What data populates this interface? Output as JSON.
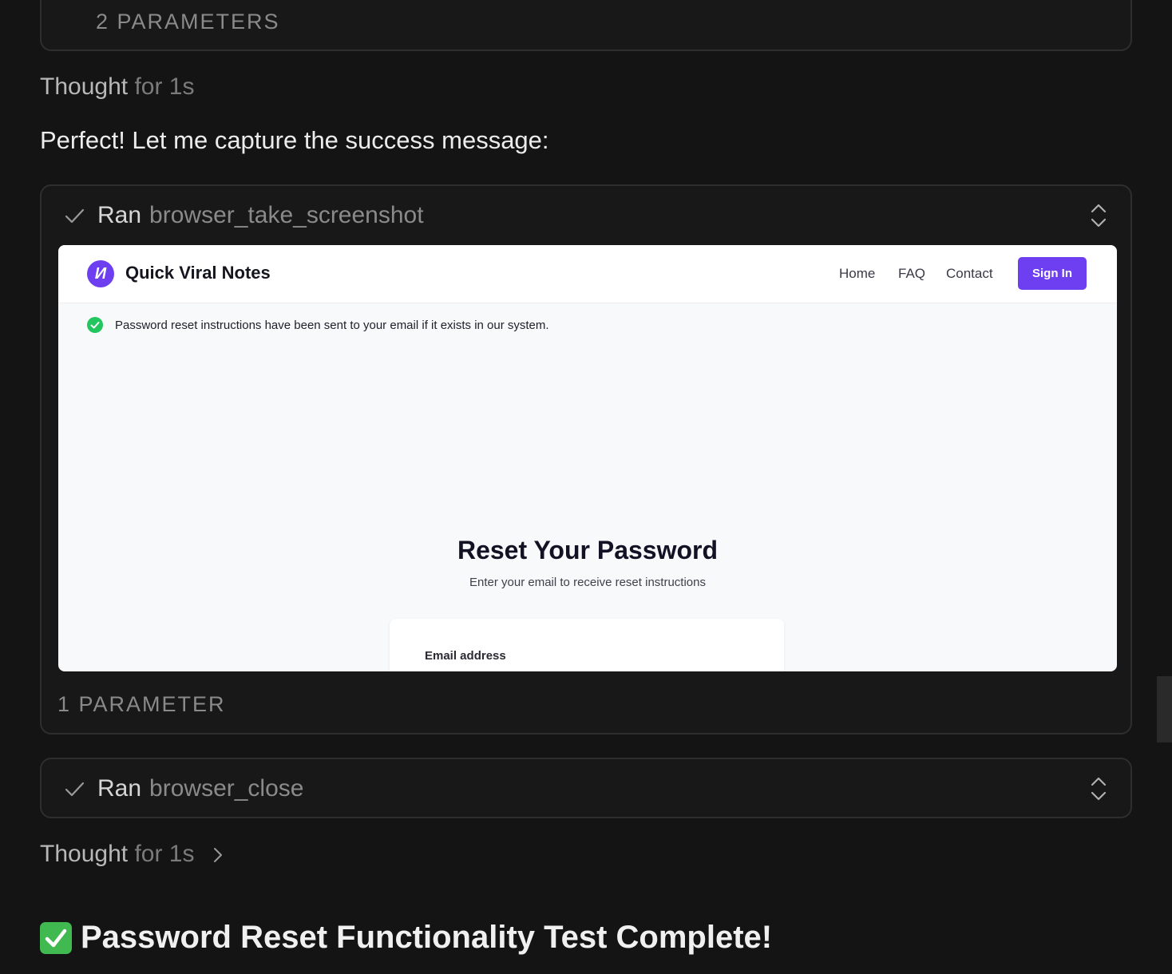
{
  "top_card": {
    "params_label": "2 PARAMETERS"
  },
  "thought_1": {
    "label": "Thought",
    "duration": "for 1s"
  },
  "message": "Perfect! Let me capture the success message:",
  "tool_screenshot": {
    "ran_label": "Ran",
    "tool_name": "browser_take_screenshot",
    "params_label": "1 PARAMETER",
    "screenshot": {
      "logo_letter": "И",
      "brand": "Quick Viral Notes",
      "nav": {
        "home": "Home",
        "faq": "FAQ",
        "contact": "Contact",
        "sign_in": "Sign In"
      },
      "success_message": "Password reset instructions have been sent to your email if it exists in our system.",
      "title": "Reset Your Password",
      "subtitle": "Enter your email to receive reset instructions",
      "email_label": "Email address"
    }
  },
  "tool_close": {
    "ran_label": "Ran",
    "tool_name": "browser_close"
  },
  "thought_2": {
    "label": "Thought",
    "duration": "for 1s"
  },
  "final_heading": "Password Reset Functionality Test Complete!",
  "colors": {
    "background": "#141414",
    "accent_purple": "#6d3ff0",
    "success_green": "#22c55e"
  }
}
